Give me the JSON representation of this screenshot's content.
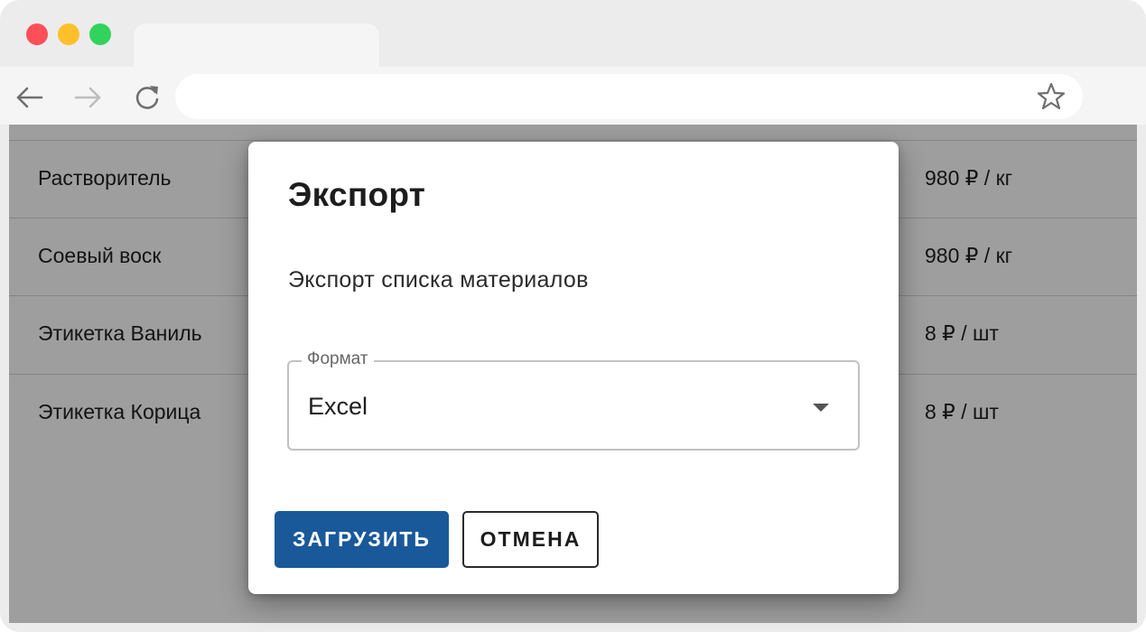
{
  "browser": {
    "address_value": ""
  },
  "table": {
    "rows": [
      {
        "name": "Растворитель",
        "price": "980 ₽ / кг"
      },
      {
        "name": "Соевый воск",
        "price": "980 ₽ / кг"
      },
      {
        "name": "Этикетка Ваниль",
        "price": "8 ₽ / шт"
      },
      {
        "name": "Этикетка Корица",
        "price": "8 ₽ / шт"
      }
    ]
  },
  "dialog": {
    "title": "Экспорт",
    "description": "Экспорт списка материалов",
    "format_field": {
      "label": "Формат",
      "value": "Excel"
    },
    "primary_button": "ЗАГРУЗИТЬ",
    "cancel_button": "ОТМЕНА"
  },
  "colors": {
    "primary": "#19599a",
    "overlay": "rgba(0,0,0,0.38)"
  },
  "icons": {
    "back": "arrow-left-icon",
    "forward": "arrow-right-icon",
    "reload": "reload-icon",
    "bookmark": "star-icon",
    "dropdown": "caret-down-icon"
  }
}
